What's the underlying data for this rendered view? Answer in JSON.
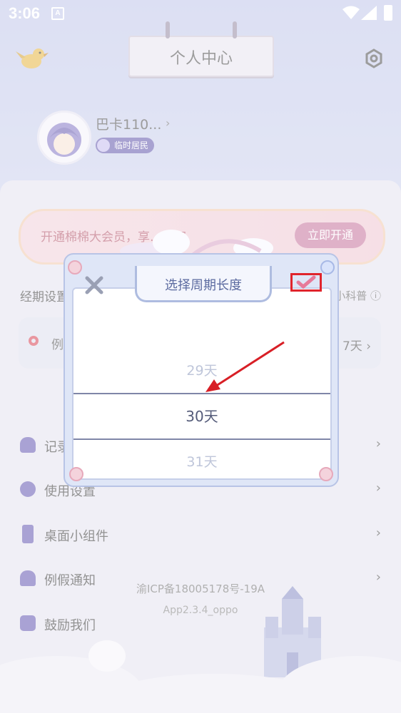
{
  "status_bar": {
    "time": "3:06",
    "notif_icon": "A"
  },
  "header": {
    "title": "个人中心"
  },
  "profile": {
    "username": "巴卡110...",
    "badge": "临时居民"
  },
  "vip_banner": {
    "text": "开通棉棉大会员，享…特权",
    "button": "立即开通"
  },
  "cycle_section": {
    "label": "经期设置",
    "right_text": "小科普"
  },
  "cycle_row": {
    "label": "例",
    "value": "7天"
  },
  "menu": [
    {
      "label": "记录"
    },
    {
      "label": "使用设置"
    },
    {
      "label": "桌面小组件"
    },
    {
      "label": "例假通知"
    },
    {
      "label": "鼓励我们"
    }
  ],
  "footer": {
    "icp": "渝ICP备18005178号-19A",
    "version": "App2.3.4_oppo"
  },
  "dialog": {
    "title": "选择周期长度",
    "options": [
      "29天",
      "30天",
      "31天"
    ],
    "selected": "30天"
  },
  "colors": {
    "accent": "#6b5fb5",
    "highlight_box": "#e0242c",
    "arrow": "#d81f26"
  }
}
